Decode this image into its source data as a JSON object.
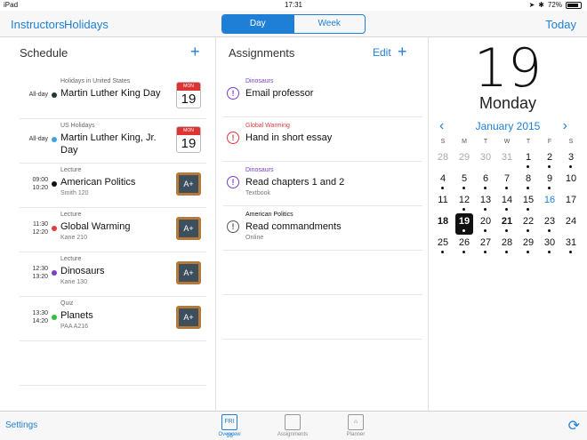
{
  "status": {
    "device": "iPad",
    "wifi": "wifi",
    "time": "17:31",
    "battery": "72%"
  },
  "nav": {
    "left1": "Instructors",
    "left2": "Holidays",
    "seg_day": "Day",
    "seg_week": "Week",
    "right": "Today"
  },
  "schedule": {
    "title": "Schedule",
    "add": "+",
    "items": [
      {
        "time1": "All-day",
        "time2": "",
        "color": "#1e3b2d",
        "cat": "Holidays in United States",
        "title": "Martin Luther King Day",
        "title2": "",
        "sub": "",
        "icon": "calendar",
        "icon_month": "MON",
        "icon_day": "19"
      },
      {
        "time1": "All-day",
        "time2": "",
        "color": "#3aa3e0",
        "cat": "US Holidays",
        "title": "Martin Luther King, Jr.",
        "title2": "Day",
        "sub": "",
        "icon": "calendar",
        "icon_month": "MON",
        "icon_day": "19"
      },
      {
        "time1": "09:00",
        "time2": "10:20",
        "color": "#111111",
        "cat": "Lecture",
        "title": "American Politics",
        "title2": "",
        "sub": "Smith 120",
        "icon": "board",
        "icon_text": "A+"
      },
      {
        "time1": "11:30",
        "time2": "12:20",
        "color": "#e23b3b",
        "cat": "Lecture",
        "title": "Global Warming",
        "title2": "",
        "sub": "Kane 210",
        "icon": "board",
        "icon_text": "A+"
      },
      {
        "time1": "12:30",
        "time2": "13:20",
        "color": "#7b3fc9",
        "cat": "Lecture",
        "title": "Dinosaurs",
        "title2": "",
        "sub": "Kane 130",
        "icon": "board",
        "icon_text": "A+"
      },
      {
        "time1": "13:30",
        "time2": "14:20",
        "color": "#2fbf3a",
        "cat": "Quiz",
        "title": "Planets",
        "title2": "",
        "sub": "PAA A216",
        "icon": "board",
        "icon_text": "A+"
      }
    ]
  },
  "assignments": {
    "title": "Assignments",
    "edit": "Edit",
    "add": "+",
    "items": [
      {
        "cat": "Dinosaurs",
        "cat_color": "#7b3fc9",
        "title": "Email professor",
        "sub": "",
        "icon_color": "#7b3fc9"
      },
      {
        "cat": "Global Warming",
        "cat_color": "#e23b3b",
        "title": "Hand in short essay",
        "sub": "",
        "icon_color": "#e23b3b"
      },
      {
        "cat": "Dinosaurs",
        "cat_color": "#7b3fc9",
        "title": "Read chapters 1 and 2",
        "sub": "Textbook",
        "icon_color": "#7b3fc9"
      },
      {
        "cat": "American Politics",
        "cat_color": "#111111",
        "title": "Read commandments",
        "sub": "Online",
        "icon_color": "#555555"
      }
    ]
  },
  "calendar": {
    "big_day": "19",
    "weekday": "Monday",
    "month": "January 2015",
    "prev": "‹",
    "next": "›",
    "dow": [
      "S",
      "M",
      "T",
      "W",
      "T",
      "F",
      "S"
    ],
    "weeks": [
      [
        {
          "d": "28",
          "g": 1
        },
        {
          "d": "29",
          "g": 1
        },
        {
          "d": "30",
          "g": 1
        },
        {
          "d": "31",
          "g": 1
        },
        {
          "d": "1",
          "m": 1
        },
        {
          "d": "2",
          "m": 1
        },
        {
          "d": "3",
          "m": 1
        }
      ],
      [
        {
          "d": "4",
          "m": 1
        },
        {
          "d": "5",
          "m": 1
        },
        {
          "d": "6",
          "m": 1
        },
        {
          "d": "7",
          "m": 1
        },
        {
          "d": "8",
          "m": 1
        },
        {
          "d": "9",
          "m": 1
        },
        {
          "d": "10"
        }
      ],
      [
        {
          "d": "11"
        },
        {
          "d": "12",
          "m": 1
        },
        {
          "d": "13",
          "m": 1
        },
        {
          "d": "14",
          "m": 1
        },
        {
          "d": "15",
          "m": 1
        },
        {
          "d": "16",
          "b": 1
        },
        {
          "d": "17"
        }
      ],
      [
        {
          "d": "18",
          "bold": 1
        },
        {
          "d": "19",
          "sel": 1,
          "m": 1
        },
        {
          "d": "20",
          "m": 1
        },
        {
          "d": "21",
          "bold": 1,
          "m": 1
        },
        {
          "d": "22",
          "m": 1
        },
        {
          "d": "23",
          "m": 1
        },
        {
          "d": "24"
        }
      ],
      [
        {
          "d": "25",
          "m": 1
        },
        {
          "d": "26",
          "m": 1
        },
        {
          "d": "27",
          "m": 1
        },
        {
          "d": "28",
          "m": 1
        },
        {
          "d": "29",
          "m": 1
        },
        {
          "d": "30",
          "m": 1
        },
        {
          "d": "31",
          "m": 1
        }
      ]
    ]
  },
  "tabbar": {
    "settings": "Settings",
    "tabs": [
      {
        "label": "Overview",
        "icon": "FRI 16"
      },
      {
        "label": "Assignments",
        "icon": ""
      },
      {
        "label": "Planner",
        "icon": "⌂"
      }
    ],
    "sync": "⟳"
  }
}
